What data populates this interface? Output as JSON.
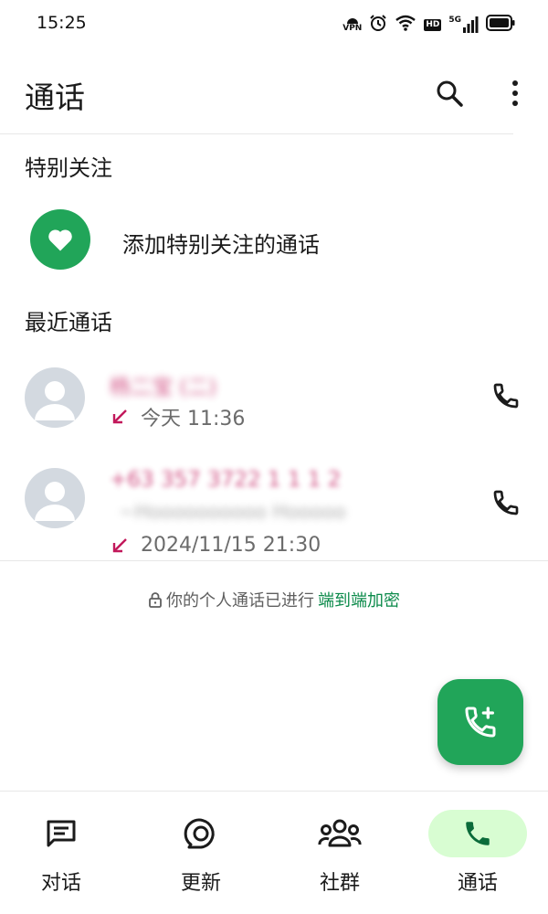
{
  "status_bar": {
    "time": "15:25",
    "vpn": "VPN",
    "hd": "HD",
    "network": "5G"
  },
  "header": {
    "title": "通话",
    "search_icon": "search-icon",
    "menu_icon": "more-vert-icon"
  },
  "favorites": {
    "title": "特别关注",
    "add_label": "添加特别关注的通话",
    "add_icon": "heart-icon",
    "accent": "#21a559"
  },
  "recent": {
    "title": "最近通话",
    "calls": [
      {
        "name": "杨二宝 (二)",
        "direction": "incoming-missed",
        "time": "今天 11:36"
      },
      {
        "name": "+63 357 3722 1 1 1 2",
        "subtitle": "~Hoooooooooo Hooooo",
        "direction": "incoming-missed",
        "time": "2024/11/15 21:30"
      }
    ]
  },
  "encryption": {
    "text": "你的个人通话已进行",
    "link": "端到端加密"
  },
  "fab": {
    "icon": "add-call-icon"
  },
  "nav": {
    "items": [
      {
        "label": "对话",
        "icon": "chats-icon"
      },
      {
        "label": "更新",
        "icon": "updates-icon"
      },
      {
        "label": "社群",
        "icon": "communities-icon"
      },
      {
        "label": "通话",
        "icon": "calls-icon",
        "active": true
      }
    ]
  },
  "colors": {
    "missed_arrow": "#c2185b",
    "link": "#0b8a4a",
    "active_nav_pill": "#d8fdd2"
  }
}
